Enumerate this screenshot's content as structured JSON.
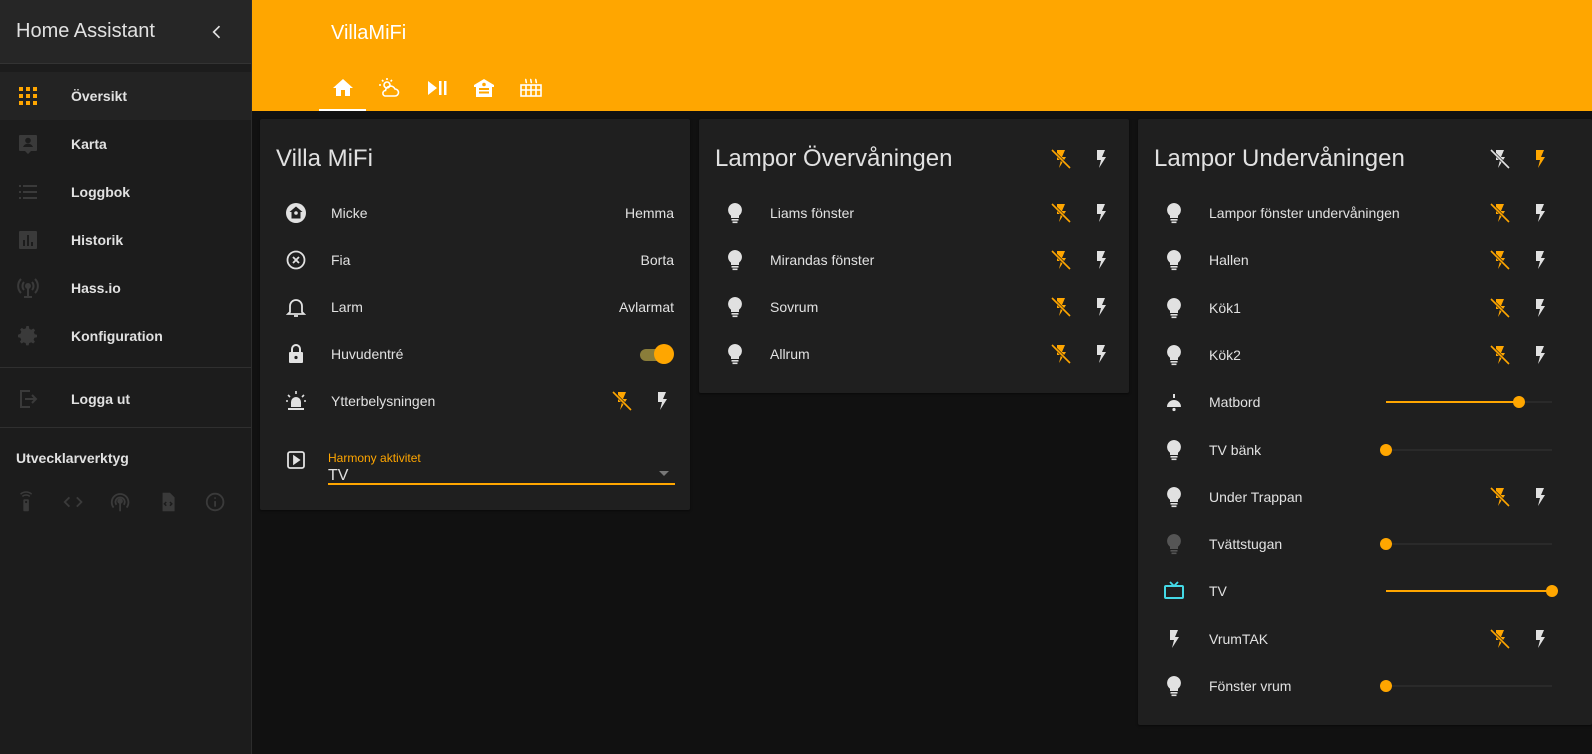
{
  "sidebar": {
    "title": "Home Assistant",
    "items": [
      {
        "label": "Översikt",
        "icon": "grid-icon"
      },
      {
        "label": "Karta",
        "icon": "map-account-icon"
      },
      {
        "label": "Loggbok",
        "icon": "list-icon"
      },
      {
        "label": "Historik",
        "icon": "chart-bar-icon"
      },
      {
        "label": "Hass.io",
        "icon": "antenna-icon"
      },
      {
        "label": "Konfiguration",
        "icon": "gear-icon"
      }
    ],
    "logout_label": "Logga ut",
    "dev_title": "Utvecklarverktyg",
    "dev_tools": [
      "remote-icon",
      "code-icon",
      "broadcast-icon",
      "file-code-icon",
      "info-icon"
    ]
  },
  "toolbar": {
    "title": "VillaMiFi",
    "tabs": [
      "home-icon",
      "weather-icon",
      "play-pause-icon",
      "garage-icon",
      "radiator-icon"
    ]
  },
  "cards": {
    "villa": {
      "title": "Villa MiFi",
      "rows": [
        {
          "name": "Micke",
          "state": "Hemma"
        },
        {
          "name": "Fia",
          "state": "Borta"
        },
        {
          "name": "Larm",
          "state": "Avlarmat"
        },
        {
          "name": "Huvudentré"
        },
        {
          "name": "Ytterbelysningen"
        }
      ],
      "select_label": "Harmony aktivitet",
      "select_value": "TV"
    },
    "upper": {
      "title": "Lampor Övervåningen",
      "rows": [
        {
          "name": "Liams fönster"
        },
        {
          "name": "Mirandas fönster"
        },
        {
          "name": "Sovrum"
        },
        {
          "name": "Allrum"
        }
      ]
    },
    "lower": {
      "title": "Lampor Undervåningen",
      "rows": [
        {
          "name": "Lampor fönster undervåningen",
          "type": "buttons"
        },
        {
          "name": "Hallen",
          "type": "buttons"
        },
        {
          "name": "Kök1",
          "type": "buttons"
        },
        {
          "name": "Kök2",
          "type": "buttons"
        },
        {
          "name": "Matbord",
          "type": "slider",
          "level": 0.8
        },
        {
          "name": "TV bänk",
          "type": "slider",
          "level": 0
        },
        {
          "name": "Under Trappan",
          "type": "buttons"
        },
        {
          "name": "Tvättstugan",
          "type": "slider",
          "level": 0
        },
        {
          "name": "TV",
          "type": "slider",
          "level": 1.0
        },
        {
          "name": "VrumTAK",
          "type": "buttons"
        },
        {
          "name": "Fönster vrum",
          "type": "slider",
          "level": 0
        }
      ]
    }
  },
  "colors": {
    "accent": "#ffa600",
    "background": "#111111",
    "card": "#1f1f1f",
    "sidebar": "#1c1c1c",
    "tv_icon": "#44d9e6"
  }
}
